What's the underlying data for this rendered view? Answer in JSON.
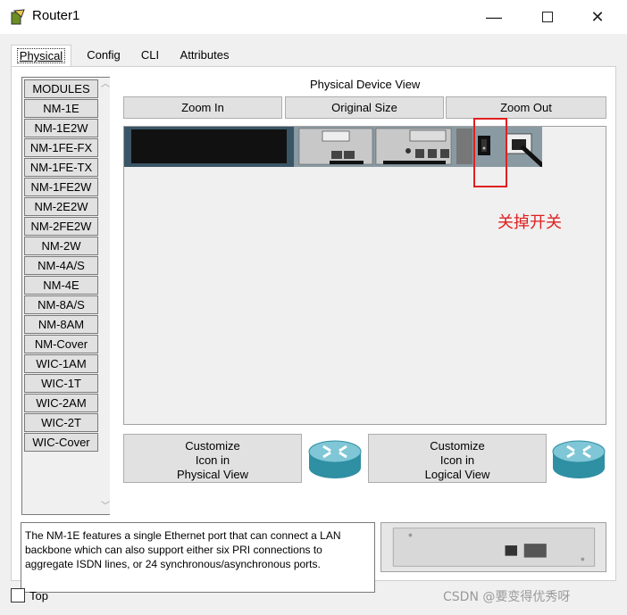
{
  "window": {
    "title": "Router1",
    "minimize_glyph": "—",
    "close_glyph": "✕"
  },
  "tabs": [
    {
      "label": "Physical",
      "active": true
    },
    {
      "label": "Config",
      "active": false
    },
    {
      "label": "CLI",
      "active": false
    },
    {
      "label": "Attributes",
      "active": false
    }
  ],
  "modules": {
    "header": "MODULES",
    "items": [
      "NM-1E",
      "NM-1E2W",
      "NM-1FE-FX",
      "NM-1FE-TX",
      "NM-1FE2W",
      "NM-2E2W",
      "NM-2FE2W",
      "NM-2W",
      "NM-4A/S",
      "NM-4E",
      "NM-8A/S",
      "NM-8AM",
      "NM-Cover",
      "WIC-1AM",
      "WIC-1T",
      "WIC-2AM",
      "WIC-2T",
      "WIC-Cover"
    ]
  },
  "device_view": {
    "label": "Physical Device View",
    "zoom_in": "Zoom In",
    "original_size": "Original Size",
    "zoom_out": "Zoom Out"
  },
  "annotation": {
    "text": "关掉开关",
    "color": "#e02020"
  },
  "customize": {
    "physical": [
      "Customize",
      "Icon in",
      "Physical View"
    ],
    "logical": [
      "Customize",
      "Icon in",
      "Logical View"
    ]
  },
  "description": "The NM-1E features a single Ethernet port that can connect a LAN backbone which can also support either six PRI connections to aggregate ISDN lines, or 24 synchronous/asynchronous ports.",
  "footer": {
    "top_label": "Top",
    "watermark": "CSDN @要变得优秀呀"
  }
}
